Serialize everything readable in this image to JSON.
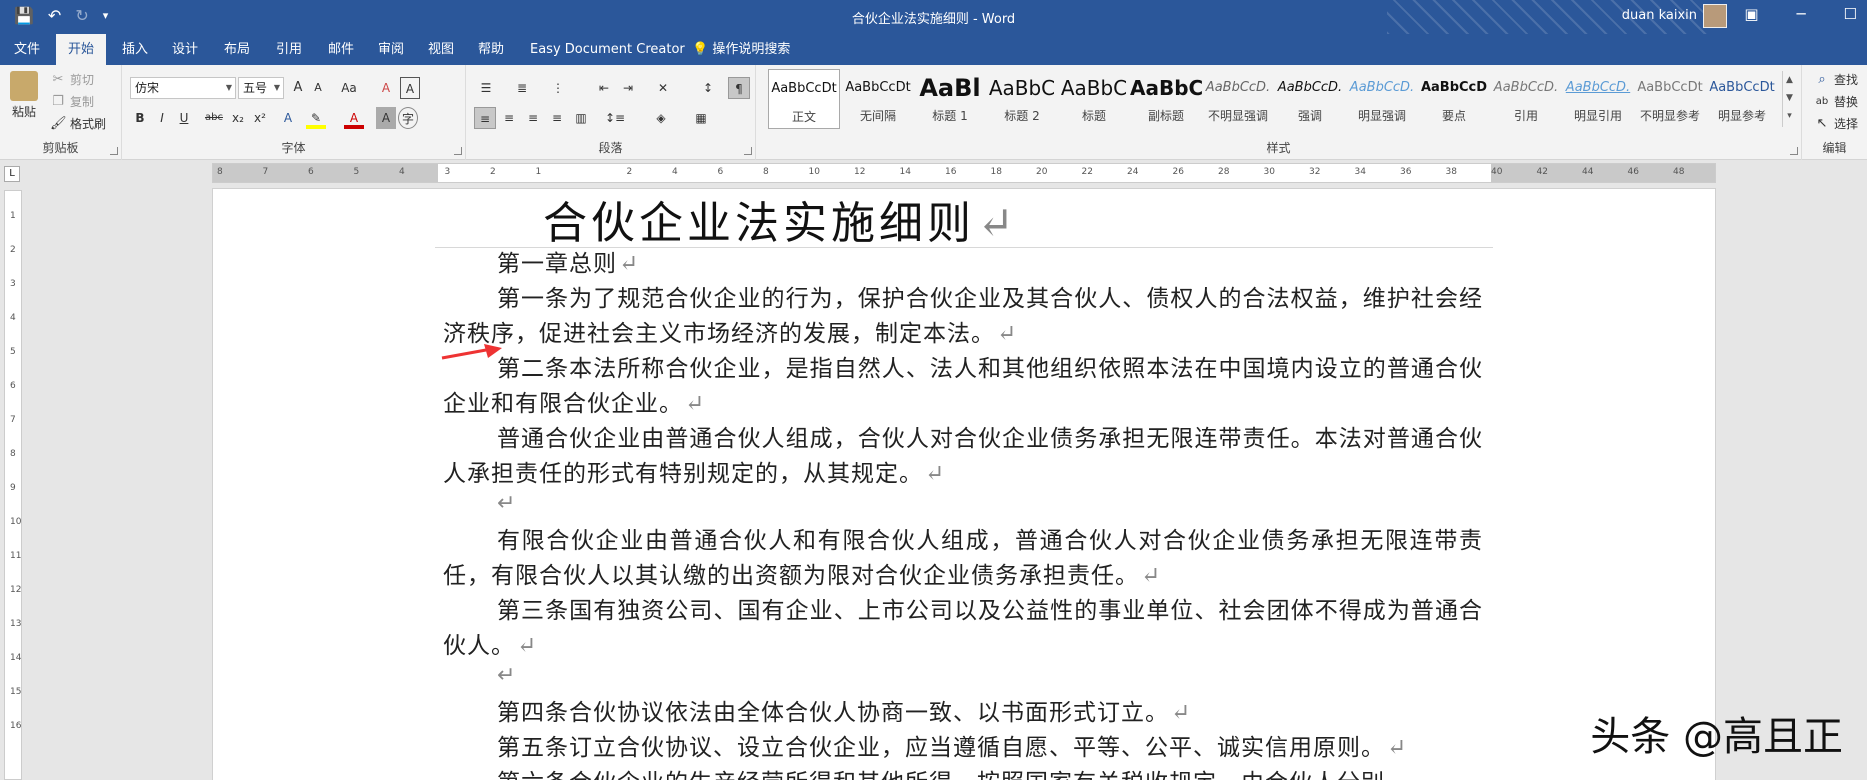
{
  "titlebar": {
    "doc_title": "合伙企业法实施细则 - Word",
    "user": "duan kaixin",
    "qat": {
      "save": "💾",
      "undo": "↶",
      "redo": "↻"
    }
  },
  "tabs": [
    {
      "label": "文件"
    },
    {
      "label": "开始"
    },
    {
      "label": "插入"
    },
    {
      "label": "设计"
    },
    {
      "label": "布局"
    },
    {
      "label": "引用"
    },
    {
      "label": "邮件"
    },
    {
      "label": "审阅"
    },
    {
      "label": "视图"
    },
    {
      "label": "帮助"
    },
    {
      "label": "Easy Document Creator"
    },
    {
      "label": "操作说明搜索"
    }
  ],
  "ribbon": {
    "clipboard": {
      "paste": "粘贴",
      "cut": "剪切",
      "copy": "复制",
      "format_painter": "格式刷",
      "label": "剪贴板"
    },
    "font": {
      "name": "仿宋",
      "size": "五号",
      "label": "字体",
      "bold": "B",
      "italic": "I",
      "underline": "U",
      "strike": "abc",
      "sub": "x₂",
      "sup": "x²",
      "grow": "A",
      "shrink": "A",
      "case": "Aa",
      "clear": "A",
      "box": "A"
    },
    "paragraph": {
      "label": "段落"
    },
    "styles": {
      "label": "样式",
      "items": [
        {
          "sample": "AaBbCcDt",
          "name": "正文"
        },
        {
          "sample": "AaBbCcDt",
          "name": "无间隔"
        },
        {
          "sample": "AaBl",
          "name": "标题 1"
        },
        {
          "sample": "AaBbC",
          "name": "标题 2"
        },
        {
          "sample": "AaBbC",
          "name": "标题"
        },
        {
          "sample": "AaBbC",
          "name": "副标题"
        },
        {
          "sample": "AaBbCcD.",
          "name": "不明显强调"
        },
        {
          "sample": "AaBbCcD.",
          "name": "强调"
        },
        {
          "sample": "AaBbCcD.",
          "name": "明显强调"
        },
        {
          "sample": "AaBbCcD",
          "name": "要点"
        },
        {
          "sample": "AaBbCcD.",
          "name": "引用"
        },
        {
          "sample": "AaBbCcD.",
          "name": "明显引用"
        },
        {
          "sample": "AaBbCcDt",
          "name": "不明显参考"
        },
        {
          "sample": "AaBbCcDt",
          "name": "明显参考"
        }
      ]
    },
    "editing": {
      "find": "查找",
      "replace": "替换",
      "select": "选择",
      "label": "编辑"
    }
  },
  "ruler": {
    "numbers": [
      "8",
      "7",
      "6",
      "5",
      "4",
      "3",
      "2",
      "1",
      "",
      "2",
      "4",
      "6",
      "8",
      "10",
      "12",
      "14",
      "16",
      "18",
      "20",
      "22",
      "24",
      "26",
      "28",
      "30",
      "32",
      "34",
      "36",
      "38",
      "40",
      "42",
      "44",
      "46",
      "48"
    ],
    "vnumbers": [
      "1",
      "2",
      "3",
      "4",
      "5",
      "6",
      "7",
      "8",
      "9",
      "10",
      "11",
      "12",
      "13",
      "14",
      "15",
      "16"
    ]
  },
  "document": {
    "title": "合伙企业法实施细则",
    "paragraphs": [
      "第一章总则",
      "第一条为了规范合伙企业的行为，保护合伙企业及其合伙人、债权人的合法权益，维护社会经济秩序，促进社会主义市场经济的发展，制定本法。",
      "第二条本法所称合伙企业，是指自然人、法人和其他组织依照本法在中国境内设立的普通合伙企业和有限合伙企业。",
      "普通合伙企业由普通合伙人组成，合伙人对合伙企业债务承担无限连带责任。本法对普通合伙人承担责任的形式有特别规定的，从其规定。",
      "有限合伙企业由普通合伙人和有限合伙人组成，普通合伙人对合伙企业债务承担无限连带责任，有限合伙人以其认缴的出资额为限对合伙企业债务承担责任。",
      "第三条国有独资公司、国有企业、上市公司以及公益性的事业单位、社会团体不得成为普通合伙人。",
      "第四条合伙协议依法由全体合伙人协商一致、以书面形式订立。",
      "第五条订立合伙协议、设立合伙企业，应当遵循自愿、平等、公平、诚实信用原则。",
      "第六条合伙企业的生产经营所得和其他所得，按照国家有关税收规定，由合伙人分别"
    ],
    "para_mark": "↵"
  },
  "watermark": "头条 @高且正"
}
